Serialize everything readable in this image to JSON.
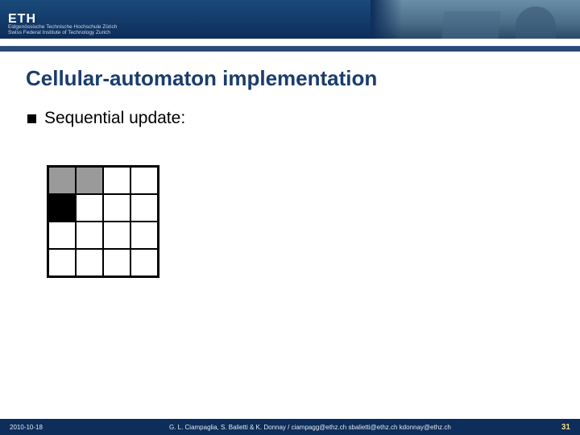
{
  "header": {
    "logo": "ETH",
    "subtitle_line1": "Eidgenössische Technische Hochschule Zürich",
    "subtitle_line2": "Swiss Federal Institute of Technology Zurich"
  },
  "slide": {
    "title": "Cellular-automaton implementation",
    "bullet1": "Sequential update:"
  },
  "grid": {
    "rows": 4,
    "cols": 4,
    "cells": [
      [
        "gray",
        "gray",
        "white",
        "white"
      ],
      [
        "black",
        "white",
        "white",
        "white"
      ],
      [
        "white",
        "white",
        "white",
        "white"
      ],
      [
        "white",
        "white",
        "white",
        "white"
      ]
    ]
  },
  "footer": {
    "date": "2010-10-18",
    "authors": "G. L. Ciampaglia, S. Balietti & K. Donnay / ciampagg@ethz.ch sbalietti@ethz.ch kdonnay@ethz.ch",
    "page": "31"
  }
}
